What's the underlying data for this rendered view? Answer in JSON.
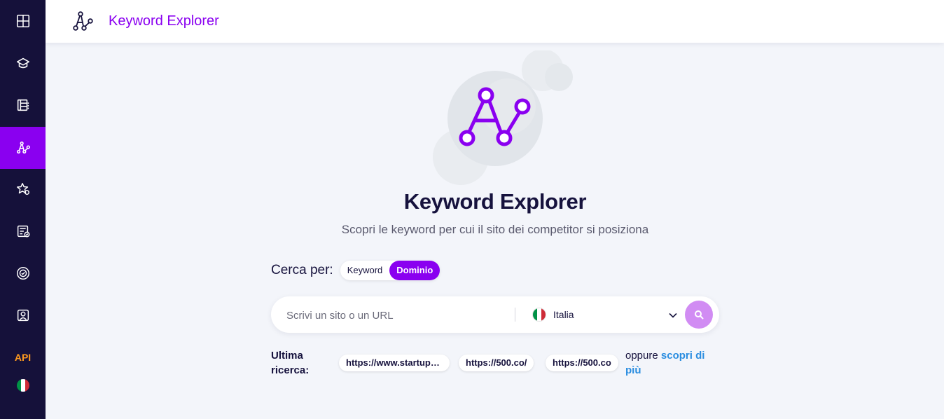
{
  "app": {
    "title": "Keyword Explorer"
  },
  "sidebar": {
    "items": [
      {
        "name": "dashboard",
        "icon": "grid-icon"
      },
      {
        "name": "projects",
        "icon": "layers-icon"
      },
      {
        "name": "reports",
        "icon": "report-icon"
      },
      {
        "name": "keyword-explorer",
        "icon": "keyword-explorer-icon",
        "active": true
      },
      {
        "name": "rankings",
        "icon": "star-settings-icon"
      },
      {
        "name": "content",
        "icon": "document-check-icon"
      },
      {
        "name": "audit",
        "icon": "target-icon"
      },
      {
        "name": "user",
        "icon": "user-frame-icon"
      }
    ],
    "api_label": "API",
    "language": "IT",
    "active_color": "#8a00f0",
    "background_color": "#15113a"
  },
  "hero": {
    "title": "Keyword Explorer",
    "subtitle": "Scopri le keyword per cui il sito dei competitor si posiziona"
  },
  "search_type": {
    "label": "Cerca per:",
    "options": [
      "Keyword",
      "Dominio"
    ],
    "selected": "Dominio"
  },
  "search": {
    "placeholder": "Scrivi un sito o un URL",
    "value": "",
    "country": "Italia",
    "button_color": "#d18cf3"
  },
  "last_searches": {
    "label_line1": "Ultima",
    "label_line2": "ricerca:",
    "items": [
      "https://www.startup…",
      "https://500.co/",
      "https://500.co"
    ],
    "or_text": "oppure",
    "learn_more_line1": "scopri di",
    "learn_more_line2": "più"
  },
  "colors": {
    "brand": "#8a00f0",
    "link": "#2a8de0",
    "api": "#ff9a1f"
  }
}
